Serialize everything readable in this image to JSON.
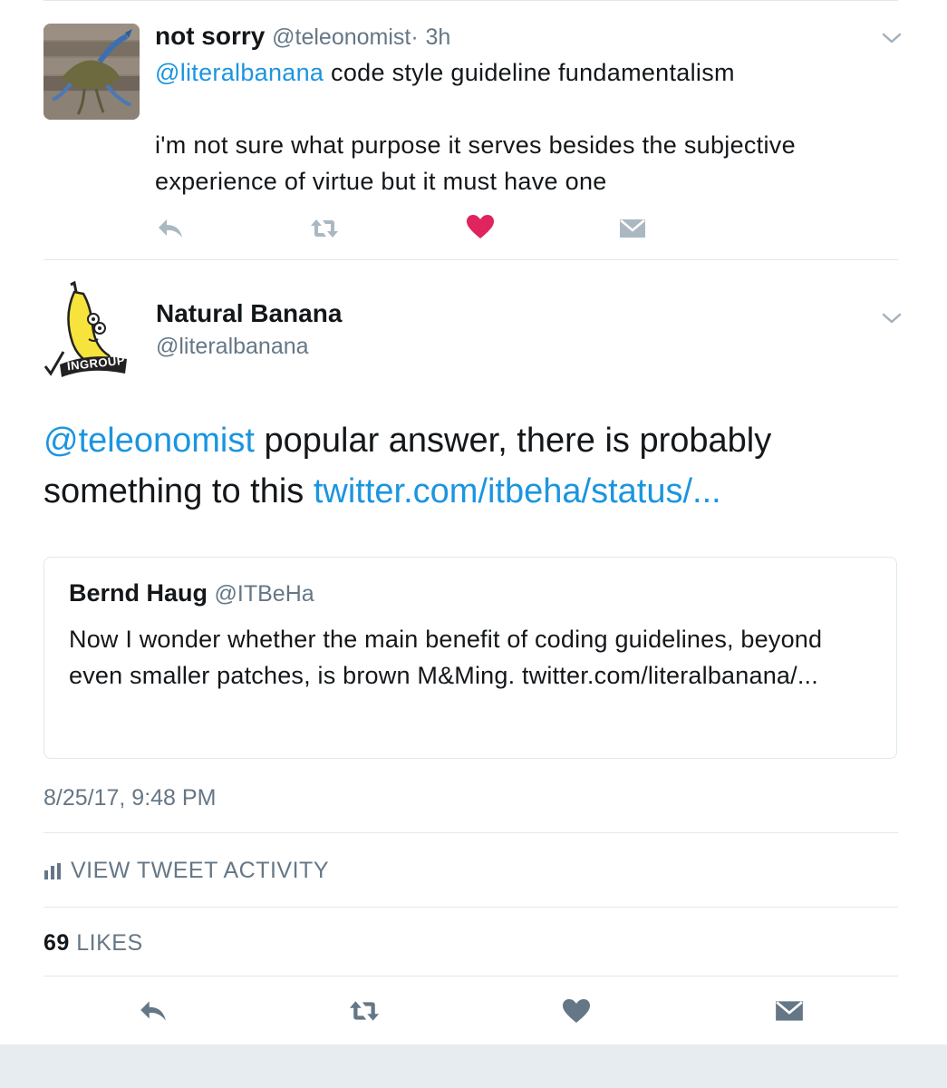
{
  "reply_tweet": {
    "name": "not sorry",
    "handle": "@teleonomist",
    "separator": "·",
    "time": "3h",
    "mention": "@literalbanana",
    "text_after_mention": " code style guideline fundamentalism",
    "paragraph2": "i'm not sure what purpose it serves besides the subjective experience of virtue but it must have one",
    "liked": true
  },
  "main_tweet": {
    "name": "Natural Banana",
    "handle": "@literalbanana",
    "avatar_badge": "INGROUP",
    "mention": "@teleonomist",
    "text": " popular answer, there is probably something to this ",
    "link": "twitter.com/itbeha/status/...",
    "quoted": {
      "name": "Bernd Haug",
      "handle": "@ITBeHa",
      "text": "Now I wonder whether the main benefit of coding guidelines, beyond even smaller patches, is brown M&Ming. twitter.com/literalbanana/..."
    },
    "timestamp": "8/25/17, 9:48 PM",
    "activity_label": "VIEW TWEET ACTIVITY",
    "likes_count": "69",
    "likes_label": "LIKES"
  },
  "colors": {
    "link": "#1b95e0",
    "muted": "#657786",
    "heart": "#e0245e",
    "divider": "#e1e8ed"
  },
  "icons": [
    "chevron-down-icon",
    "reply-icon",
    "retweet-icon",
    "heart-icon",
    "direct-message-icon",
    "bar-chart-icon"
  ]
}
